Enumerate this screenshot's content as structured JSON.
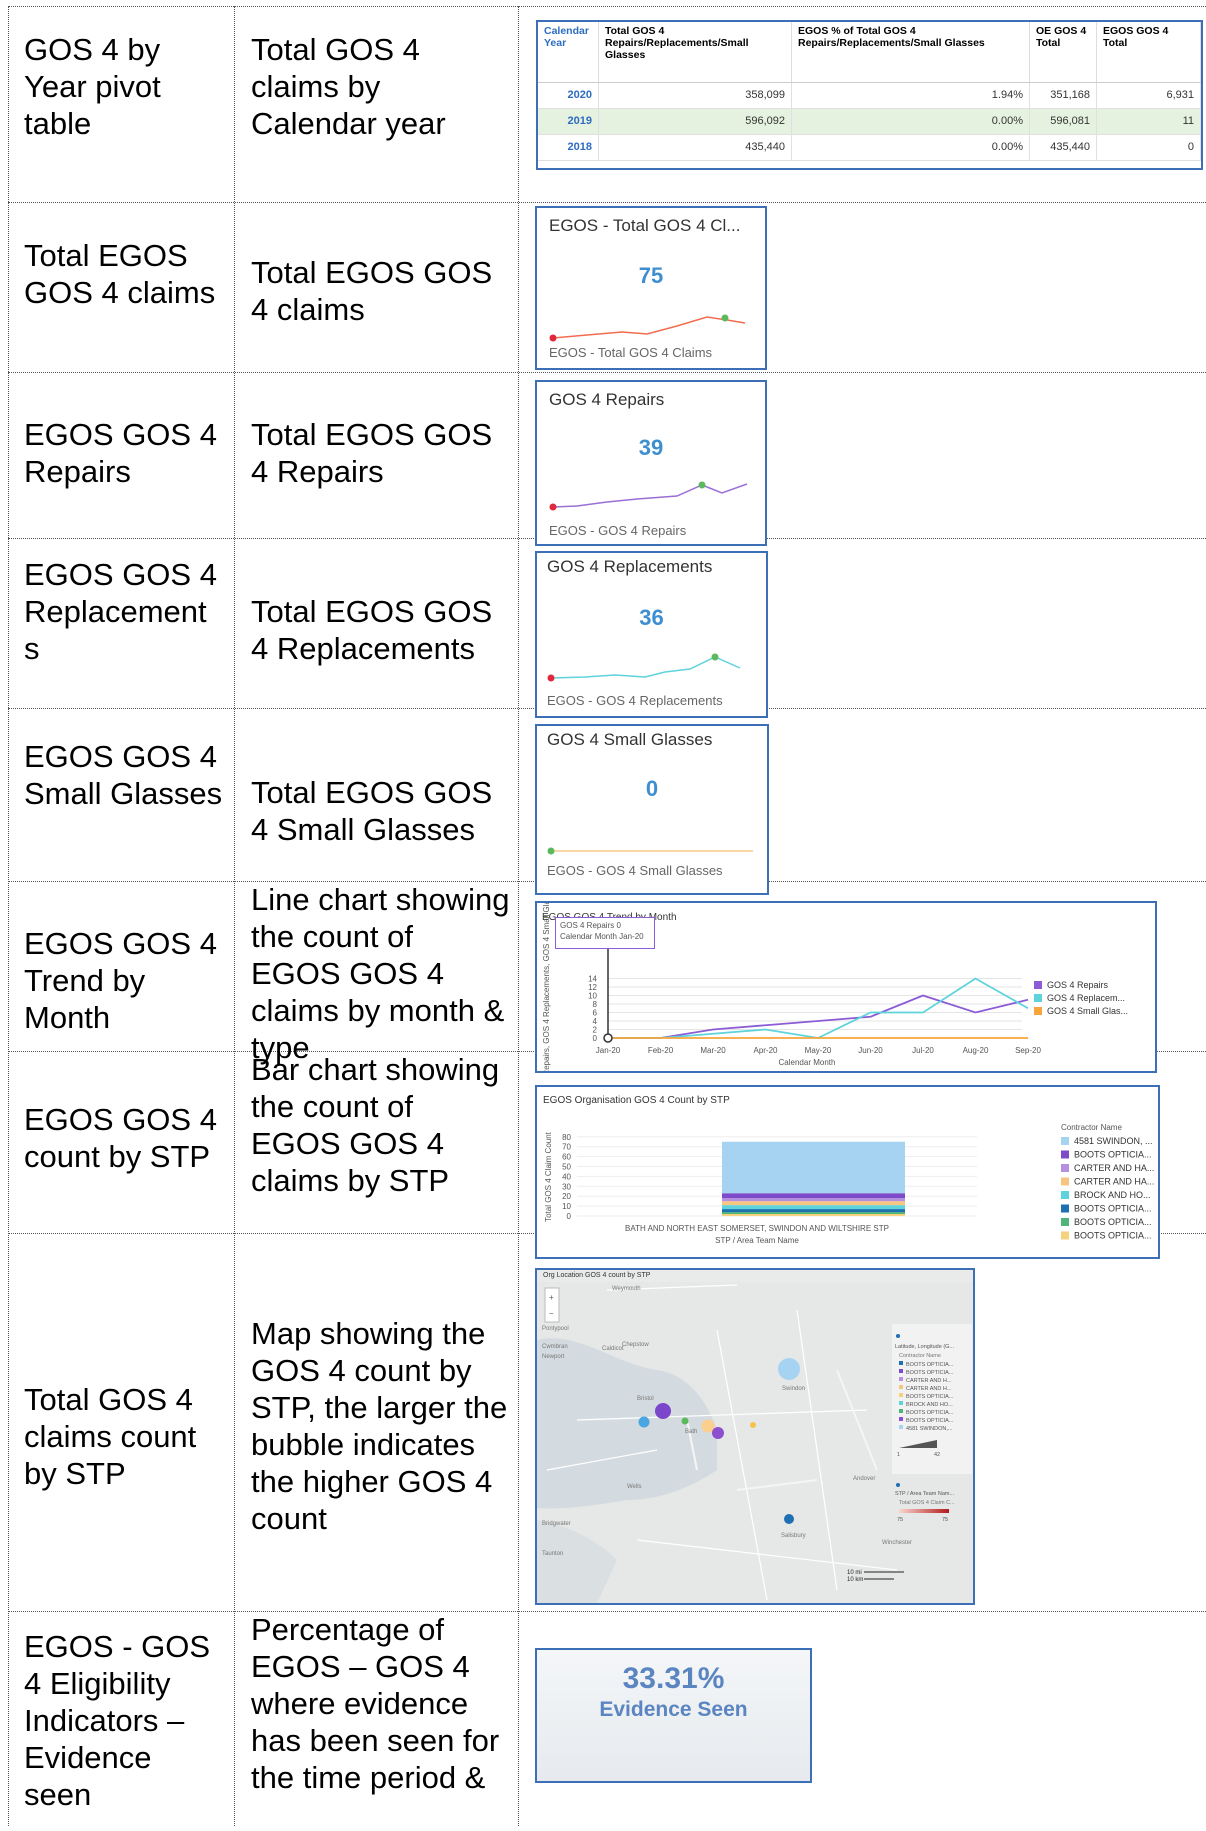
{
  "rows": [
    {
      "name": "GOS 4 by Year pivot table",
      "desc": "Total GOS 4 claims by Calendar year"
    },
    {
      "name": "Total EGOS GOS 4 claims",
      "desc": "Total EGOS GOS 4 claims"
    },
    {
      "name": "EGOS GOS 4 Repairs",
      "desc": "Total EGOS GOS 4 Repairs"
    },
    {
      "name": "EGOS GOS 4 Replacements",
      "desc": "Total EGOS GOS 4 Replacements"
    },
    {
      "name": "EGOS GOS 4 Small Glasses",
      "desc": "Total EGOS GOS 4 Small Glasses"
    },
    {
      "name": "EGOS GOS 4 Trend by Month",
      "desc": "Line chart showing the count of EGOS GOS 4 claims by month & type"
    },
    {
      "name": "EGOS GOS 4 count by STP",
      "desc": "Bar chart showing the count of EGOS GOS 4 claims by STP"
    },
    {
      "name": "Total GOS 4 claims count by STP",
      "desc": "Map showing the GOS 4 count by STP, the larger the bubble indicates the higher GOS 4 count"
    },
    {
      "name": "EGOS - GOS 4 Eligibility Indicators – Evidence seen",
      "desc": "Percentage of EGOS – GOS 4 where evidence has been seen for the time period &"
    }
  ],
  "pivot": {
    "headers": [
      "Calendar Year",
      "Total GOS 4 Repairs/Replacements/Small Glasses",
      "EGOS % of Total GOS 4 Repairs/Replacements/Small Glasses",
      "OE GOS 4 Total",
      "EGOS GOS 4 Total"
    ],
    "rows": [
      [
        "2020",
        "358,099",
        "1.94%",
        "351,168",
        "6,931"
      ],
      [
        "2019",
        "596,092",
        "0.00%",
        "596,081",
        "11"
      ],
      [
        "2018",
        "435,440",
        "0.00%",
        "435,440",
        "0"
      ]
    ]
  },
  "tiles": [
    {
      "title": "EGOS - Total GOS 4 Cl...",
      "value": "75",
      "footer": "EGOS - Total GOS 4 Claims",
      "color": "#f26d4f"
    },
    {
      "title": "GOS 4 Repairs",
      "value": "39",
      "footer": "EGOS - GOS 4 Repairs",
      "color": "#9a6fd6"
    },
    {
      "title": "GOS 4 Replacements",
      "value": "36",
      "footer": "EGOS - GOS 4 Replacements",
      "color": "#5fd3dc"
    },
    {
      "title": "GOS 4 Small Glasses",
      "value": "0",
      "footer": "EGOS - GOS 4 Small Glasses",
      "color": "#f8c98a"
    }
  ],
  "trend": {
    "title": "EGOS GOS 4 Trend by Month",
    "tooltip": [
      "GOS 4 Repairs 0",
      "Calendar Month Jan-20"
    ],
    "ylabel": "GOS 4 Repairs, GOS 4 Replacements, GOS 4 Small Glasses",
    "xlabel": "Calendar Month",
    "yticks": [
      "0",
      "2",
      "4",
      "6",
      "8",
      "10",
      "12",
      "14"
    ],
    "legend": [
      "GOS 4 Repairs",
      "GOS 4 Replacem...",
      "GOS 4 Small Glas..."
    ]
  },
  "stp": {
    "title": "EGOS Organisation GOS 4 Count by STP",
    "ylabel": "Total GOS 4 Claim Count",
    "xlabel": "STP / Area Team Name",
    "category": "BATH AND NORTH EAST SOMERSET, SWINDON AND WILTSHIRE STP",
    "yticks": [
      "0",
      "10",
      "20",
      "30",
      "40",
      "50",
      "60",
      "70",
      "80"
    ],
    "legend_title": "Contractor Name",
    "legend": [
      "4581 SWINDON, ...",
      "BOOTS OPTICIA...",
      "CARTER AND HA...",
      "CARTER AND HA...",
      "BROCK AND HO...",
      "BOOTS OPTICIA...",
      "BOOTS OPTICIA...",
      "BOOTS OPTICIA..."
    ]
  },
  "map": {
    "title": "Org Location GOS 4 count by STP",
    "places": [
      "Weymouth",
      "Pontypool",
      "Chepstow",
      "Cwmbran",
      "Caldicot",
      "Newport",
      "Swindon",
      "Bristol",
      "Bath",
      "Wells",
      "Bridgwater",
      "Andover",
      "Salisbury",
      "Winchester",
      "Taunton"
    ],
    "legend1_title": "Latitude, Longitude (G...",
    "legend1_sub": "Contractor Name",
    "legend1": [
      "BOOTS OPTICIA...",
      "BOOTS OPTICIA...",
      "CARTER AND H...",
      "CARTER AND H...",
      "BOOTS OPTICIA...",
      "BROCK AND HO...",
      "BOOTS OPTICIA...",
      "BOOTS OPTICIA...",
      "4581 SWINDON,..."
    ],
    "legend1_range": [
      "1",
      "42"
    ],
    "legend2_title": "STP / Area Team Nam...",
    "legend2_sub": "Total GOS 4 Claim C...",
    "legend2_range": [
      "75",
      "75"
    ],
    "scale": [
      "10 mi",
      "10 km"
    ]
  },
  "evidence": {
    "value": "33.31%",
    "label": "Evidence Seen"
  }
}
